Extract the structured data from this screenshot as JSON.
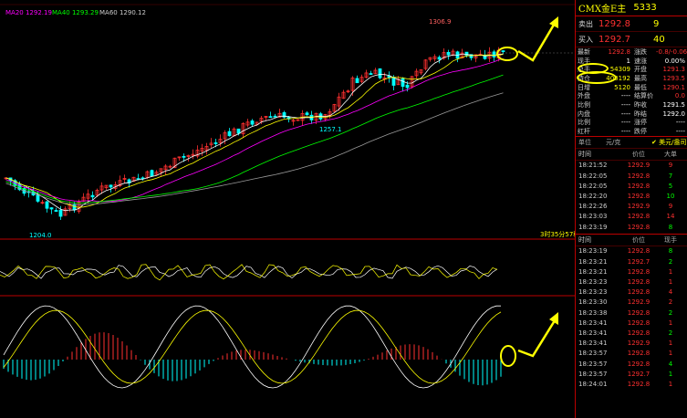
{
  "ma_legend": {
    "ma20": "MA20 1292.19",
    "ma40": "MA40 1293.29",
    "ma60": "MA60 1290.12"
  },
  "chart_labels": {
    "high_label": "1306.9",
    "mid_low_label": "1257.1",
    "low_label": "1204.0",
    "time_readout": "3时35分57秒"
  },
  "colors": {
    "up": "#ff3030",
    "down": "#00ffff",
    "ma20": "#ff00ff",
    "ma40": "#00ff00",
    "ma60": "#ffff00",
    "border": "#bb0000",
    "highlight": "#ffff00"
  },
  "panel": {
    "name": "CMX金E主",
    "code": "5333",
    "sell": {
      "label": "卖出",
      "price": "1292.8",
      "vol": "9"
    },
    "buy": {
      "label": "买入",
      "price": "1292.7",
      "vol": "40"
    },
    "quote_rows": [
      {
        "l1": "最新",
        "v1": "1292.8",
        "c1": "red",
        "l2": "涨跌",
        "v2": "-0.8/-0.06%",
        "c2": "red"
      },
      {
        "l1": "现手",
        "v1": "1",
        "c1": "wht",
        "l2": "速涨",
        "v2": "0.00%",
        "c2": "wht"
      },
      {
        "l1": "总手",
        "v1": "54309",
        "c1": "yel",
        "l2": "开盘",
        "v2": "1291.3",
        "c2": "red"
      },
      {
        "l1": "持仓",
        "v1": "400192",
        "c1": "yel",
        "l2": "最高",
        "v2": "1293.5",
        "c2": "red"
      },
      {
        "l1": "日增",
        "v1": "5120",
        "c1": "yel",
        "l2": "最低",
        "v2": "1290.1",
        "c2": "red"
      },
      {
        "l1": "外盘",
        "v1": "----",
        "c1": "wht",
        "l2": "结算价",
        "v2": "0.0",
        "c2": "red"
      },
      {
        "l1": "比例",
        "v1": "----",
        "c1": "wht",
        "l2": "昨收",
        "v2": "1291.5",
        "c2": "wht"
      },
      {
        "l1": "内盘",
        "v1": "----",
        "c1": "wht",
        "l2": "昨结",
        "v2": "1292.0",
        "c2": "wht"
      },
      {
        "l1": "比例",
        "v1": "----",
        "c1": "wht",
        "l2": "涨停",
        "v2": "----",
        "c2": "wht"
      },
      {
        "l1": "红杆",
        "v1": "----",
        "c1": "wht",
        "l2": "跌停",
        "v2": "----",
        "c2": "wht"
      }
    ],
    "unit_row": {
      "label": "单位",
      "unit": "元/克",
      "currency": "美元/盎司"
    },
    "trades_header": {
      "time": "时间",
      "price": "价位",
      "vol": "大单"
    },
    "trades_header2": {
      "time": "时间",
      "price": "价位",
      "vol": "现手"
    },
    "trades1": [
      {
        "t": "18:21:52",
        "p": "1292.9",
        "v": "9",
        "c": "red"
      },
      {
        "t": "18:22:05",
        "p": "1292.8",
        "v": "7",
        "c": "grn"
      },
      {
        "t": "18:22:05",
        "p": "1292.8",
        "v": "5",
        "c": "grn"
      },
      {
        "t": "18:22:20",
        "p": "1292.8",
        "v": "10",
        "c": "grn"
      },
      {
        "t": "18:22:26",
        "p": "1292.9",
        "v": "9",
        "c": "red"
      },
      {
        "t": "18:23:03",
        "p": "1292.8",
        "v": "14",
        "c": "red"
      },
      {
        "t": "18:23:19",
        "p": "1292.8",
        "v": "8",
        "c": "grn"
      }
    ],
    "trades2": [
      {
        "t": "18:23:19",
        "p": "1292.8",
        "v": "8",
        "c": "grn"
      },
      {
        "t": "18:23:21",
        "p": "1292.7",
        "v": "2",
        "c": "grn"
      },
      {
        "t": "18:23:21",
        "p": "1292.8",
        "v": "1",
        "c": "red"
      },
      {
        "t": "18:23:23",
        "p": "1292.8",
        "v": "1",
        "c": "red"
      },
      {
        "t": "18:23:23",
        "p": "1292.8",
        "v": "4",
        "c": "red"
      },
      {
        "t": "18:23:30",
        "p": "1292.9",
        "v": "2",
        "c": "red"
      },
      {
        "t": "18:23:38",
        "p": "1292.8",
        "v": "2",
        "c": "grn"
      },
      {
        "t": "18:23:41",
        "p": "1292.8",
        "v": "1",
        "c": "red"
      },
      {
        "t": "18:23:41",
        "p": "1292.8",
        "v": "2",
        "c": "grn"
      },
      {
        "t": "18:23:41",
        "p": "1292.9",
        "v": "1",
        "c": "red"
      },
      {
        "t": "18:23:57",
        "p": "1292.8",
        "v": "1",
        "c": "red"
      },
      {
        "t": "18:23:57",
        "p": "1292.8",
        "v": "4",
        "c": "grn"
      },
      {
        "t": "18:23:57",
        "p": "1292.7",
        "v": "1",
        "c": "grn"
      },
      {
        "t": "18:24:01",
        "p": "1292.8",
        "v": "1",
        "c": "red"
      }
    ]
  }
}
